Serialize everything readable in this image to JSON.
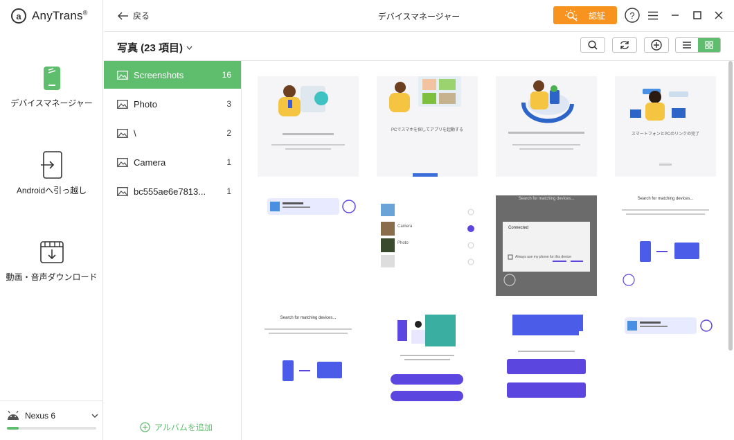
{
  "app": {
    "name": "AnyTrans",
    "reg": "®"
  },
  "sidebar": {
    "items": [
      {
        "label": "デバイスマネージャー",
        "icon": "phone-icon"
      },
      {
        "label": "Androidへ引っ越し",
        "icon": "phone-transfer-icon"
      },
      {
        "label": "動画・音声ダウンロード",
        "icon": "video-download-icon"
      }
    ],
    "device": {
      "name": "Nexus 6",
      "storage_used_fraction": 0.13
    }
  },
  "topbar": {
    "back_label": "戻る",
    "title": "デバイスマネージャー",
    "auth_label": "認証"
  },
  "subheader": {
    "title": "写真 (23 項目)"
  },
  "albums": {
    "items": [
      {
        "name": "Screenshots",
        "count": "16",
        "active": true
      },
      {
        "name": "Photo",
        "count": "3"
      },
      {
        "name": "\\",
        "count": "2"
      },
      {
        "name": "Camera",
        "count": "1"
      },
      {
        "name": "bc555ae6e7813...",
        "count": "1"
      }
    ],
    "add_label": "アルバムを追加"
  },
  "colors": {
    "accent": "#5fbe6e",
    "auth": "#f7931e",
    "purple": "#5b46e0"
  },
  "thumbnails": {
    "t2_caption": "PCでスマホを探してアプリを起動する",
    "t4_caption": "スマートフォンとPCのリンクの完了",
    "t6_item1": "Camera",
    "t6_item2": "Photo",
    "t7_title": "Search for matching devices...",
    "t7_dialog_title": "Connected",
    "t7_checkbox_label": "Always use my phone for this device",
    "t8_title": "Search for matching devices...",
    "t9_title": "Search for matching devices..."
  }
}
